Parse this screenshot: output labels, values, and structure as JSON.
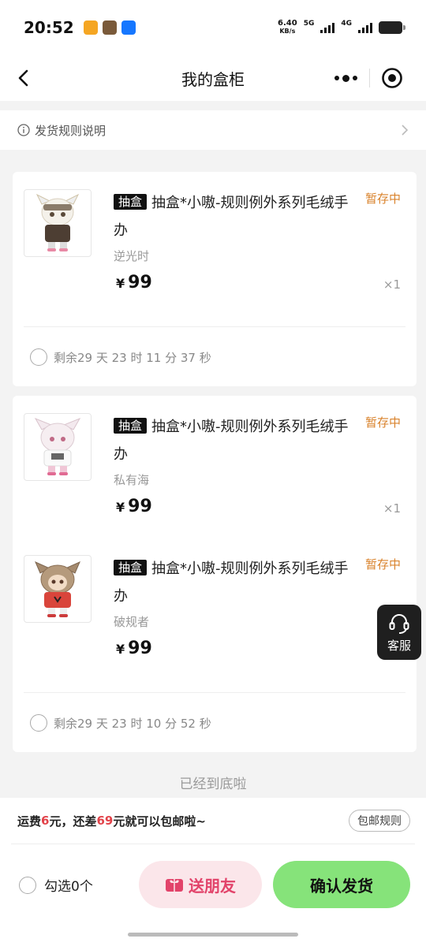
{
  "status_bar": {
    "time": "20:52",
    "net_speed_value": "6.40",
    "net_speed_unit": "KB/s",
    "sim1_label": "5G",
    "sim2_label": "4G"
  },
  "nav": {
    "title": "我的盒柜"
  },
  "rules_link": {
    "label": "发货规则说明"
  },
  "groups": [
    {
      "items": [
        {
          "tag": "抽盒",
          "title": "抽盒*小嗷-规则例外系列毛绒手办",
          "status": "暂存中",
          "variant": "逆光时",
          "currency": "¥",
          "price": "99",
          "qty": "×1"
        }
      ],
      "timer": "剩余29 天 23 时 11 分 37 秒"
    },
    {
      "items": [
        {
          "tag": "抽盒",
          "title": "抽盒*小嗷-规则例外系列毛绒手办",
          "status": "暂存中",
          "variant": "私有海",
          "currency": "¥",
          "price": "99",
          "qty": "×1"
        },
        {
          "tag": "抽盒",
          "title": "抽盒*小嗷-规则例外系列毛绒手办",
          "status": "暂存中",
          "variant": "破规者",
          "currency": "¥",
          "price": "99",
          "qty": ""
        }
      ],
      "timer": "剩余29 天 23 时 10 分 52 秒"
    }
  ],
  "end_text": "已经到底啦",
  "customer_service": {
    "label": "客服"
  },
  "footer": {
    "shipping_prefix": "运费",
    "shipping_fee": "6",
    "shipping_mid": "元，还差",
    "shipping_gap": "69",
    "shipping_suffix": "元就可以包邮啦~",
    "free_shipping_rules": "包邮规则",
    "select_label": "勾选0个",
    "send_friend": "送朋友",
    "confirm": "确认发货"
  },
  "colors": {
    "accent_status": "#d9822b",
    "price_red": "#e2434a",
    "confirm_green": "#86e37a",
    "friend_pink": "#fbe6ea"
  }
}
